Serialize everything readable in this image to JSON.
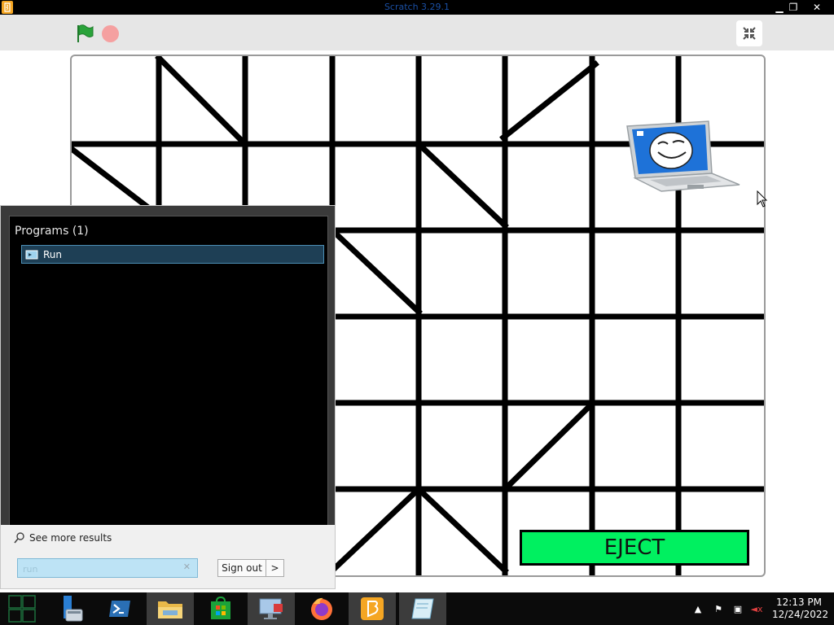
{
  "window": {
    "title": "Scratch 3.29.1",
    "minimize": "▁",
    "maximize": "❐",
    "close": "✕"
  },
  "toolbar": {
    "green_flag": "green-flag-icon",
    "stop": "stop-icon",
    "exit_fullscreen": "exit-fullscreen-icon",
    "flag_color": "#2aa33a",
    "stop_color": "#f5a0a0"
  },
  "stage": {
    "eject_label": "EJECT",
    "eject_color": "#00f060"
  },
  "start_menu": {
    "section_title": "Programs (1)",
    "results": [
      {
        "label": "Run",
        "icon": "run-icon"
      }
    ],
    "see_more": "See more results",
    "search_value": "run",
    "search_clear": "✕",
    "signout_label": "Sign out",
    "signout_arrow": ">"
  },
  "taskbar": {
    "items": [
      {
        "name": "start",
        "icon": "start-tiles-icon"
      },
      {
        "name": "server-manager",
        "icon": "server-manager-icon"
      },
      {
        "name": "powershell",
        "icon": "powershell-icon"
      },
      {
        "name": "file-explorer",
        "icon": "folder-icon"
      },
      {
        "name": "store",
        "icon": "store-icon"
      },
      {
        "name": "remote-desktop",
        "icon": "monitor-icon"
      },
      {
        "name": "firefox",
        "icon": "firefox-icon"
      },
      {
        "name": "scratch",
        "icon": "scratch-icon"
      },
      {
        "name": "notepad",
        "icon": "notepad-icon"
      }
    ],
    "tray": {
      "show_hidden": "▲",
      "flag": "⚑",
      "network": "▣",
      "volume": "◄x"
    },
    "clock": {
      "time": "12:13 PM",
      "date": "12/24/2022"
    }
  }
}
